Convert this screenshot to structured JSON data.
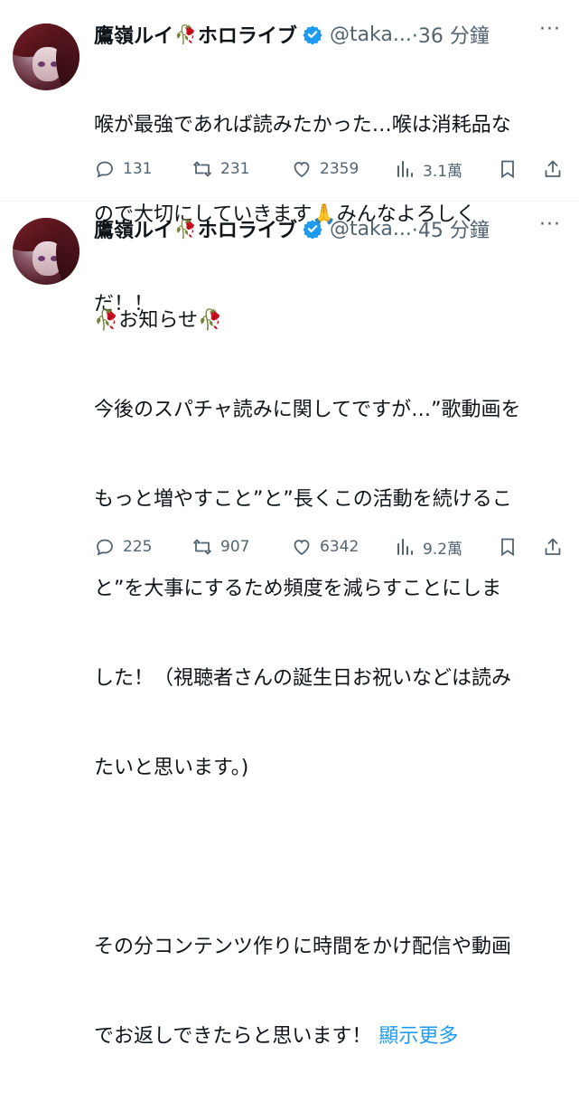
{
  "tweets": [
    {
      "name": "鷹嶺ルイ",
      "name_suffix": "ホロライブ",
      "rose": "🥀",
      "handle": "@taka...",
      "time": "·36 分鐘",
      "more": "···",
      "text": "喉が最強であれば読みたかった…喉は消耗品なので大切にしていきます🙏みんなよろしくだ！！",
      "line1": "喉が最強であれば読みたかった…喉は消耗品な",
      "line2": "ので大切にしていきます🙏みんなよろしく",
      "line3": "だ！！",
      "replies": "131",
      "retweets": "231",
      "likes": "2359",
      "views": "3.1萬"
    },
    {
      "name": "鷹嶺ルイ",
      "name_suffix": "ホロライブ",
      "rose": "🥀",
      "handle": "@taka...",
      "time": "·45 分鐘",
      "more": "···",
      "notice": "🥀お知らせ🥀",
      "line1": "今後のスパチャ読みに関してですが…”歌動画を",
      "line2": "もっと増やすこと”と”長くこの活動を続けるこ",
      "line3": "と”を大事にするため頻度を減らすことにしま",
      "line4": "した！（視聴者さんの誕生日お祝いなどは読み",
      "line5": "たいと思います。)",
      "line6": "その分コンテンツ作りに時間をかけ配信や動画",
      "line7": "でお返しできたらと思います！",
      "show_more": "顯示更多",
      "replies": "225",
      "retweets": "907",
      "likes": "6342",
      "views": "9.2萬"
    }
  ],
  "colors": {
    "verified": "#1d9bf0",
    "link": "#1d9bf0",
    "secondary": "#536471"
  }
}
